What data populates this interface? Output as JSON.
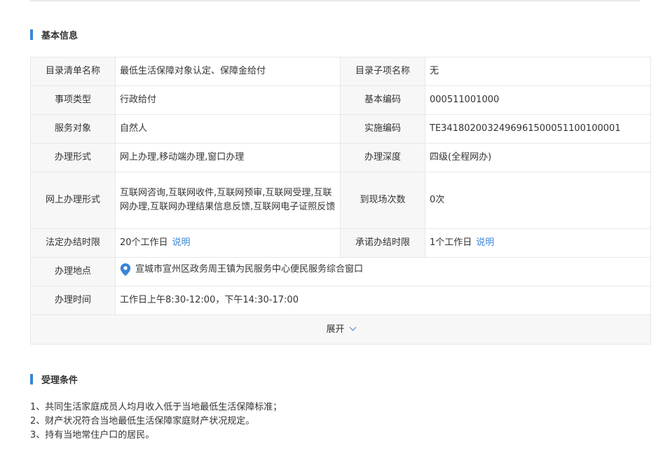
{
  "basic_info": {
    "title": "基本信息",
    "rows": {
      "catalog_name_label": "目录清单名称",
      "catalog_name_value": "最低生活保障对象认定、保障金给付",
      "sub_item_label": "目录子项名称",
      "sub_item_value": "无",
      "item_type_label": "事项类型",
      "item_type_value": "行政给付",
      "basic_code_label": "基本编码",
      "basic_code_value": "000511001000",
      "service_target_label": "服务对象",
      "service_target_value": "自然人",
      "impl_code_label": "实施编码",
      "impl_code_value": "TE341802003249696150005110010000 1",
      "handle_form_label": "办理形式",
      "handle_form_value": "网上办理,移动端办理,窗口办理",
      "handle_depth_label": "办理深度",
      "handle_depth_value": "四级(全程网办)",
      "online_form_label": "网上办理形式",
      "online_form_value": "互联网咨询,互联网收件,互联网预审,互联网受理,互联网办理,互联网办理结果信息反馈,互联网电子证照反馈",
      "visits_label": "到现场次数",
      "visits_value": "0次",
      "legal_limit_label": "法定办结时限",
      "legal_limit_value": "20个工作日",
      "legal_limit_link": "说明",
      "promised_limit_label": "承诺办结时限",
      "promised_limit_value": "1个工作日",
      "promised_limit_link": "说明",
      "location_label": "办理地点",
      "location_value": "宣城市宣州区政务周王镇为民服务中心便民服务综合窗口",
      "time_label": "办理时间",
      "time_value": "工作日上午8:30-12:00，下午14:30-17:00"
    },
    "expand_label": "展开"
  },
  "conditions": {
    "title": "受理条件",
    "items": [
      "1、共同生活家庭成员人均月收入低于当地最低生活保障标准；",
      "2、财产状况符合当地最低生活保障家庭财产状况规定。",
      "3、持有当地常住户口的居民。"
    ]
  },
  "colors": {
    "accent": "#3a86d6",
    "label_bg": "#f7f7f7",
    "border": "#e8e8e8"
  },
  "icons": {
    "location": "location-pin-icon",
    "expand": "chevron-down-icon"
  }
}
